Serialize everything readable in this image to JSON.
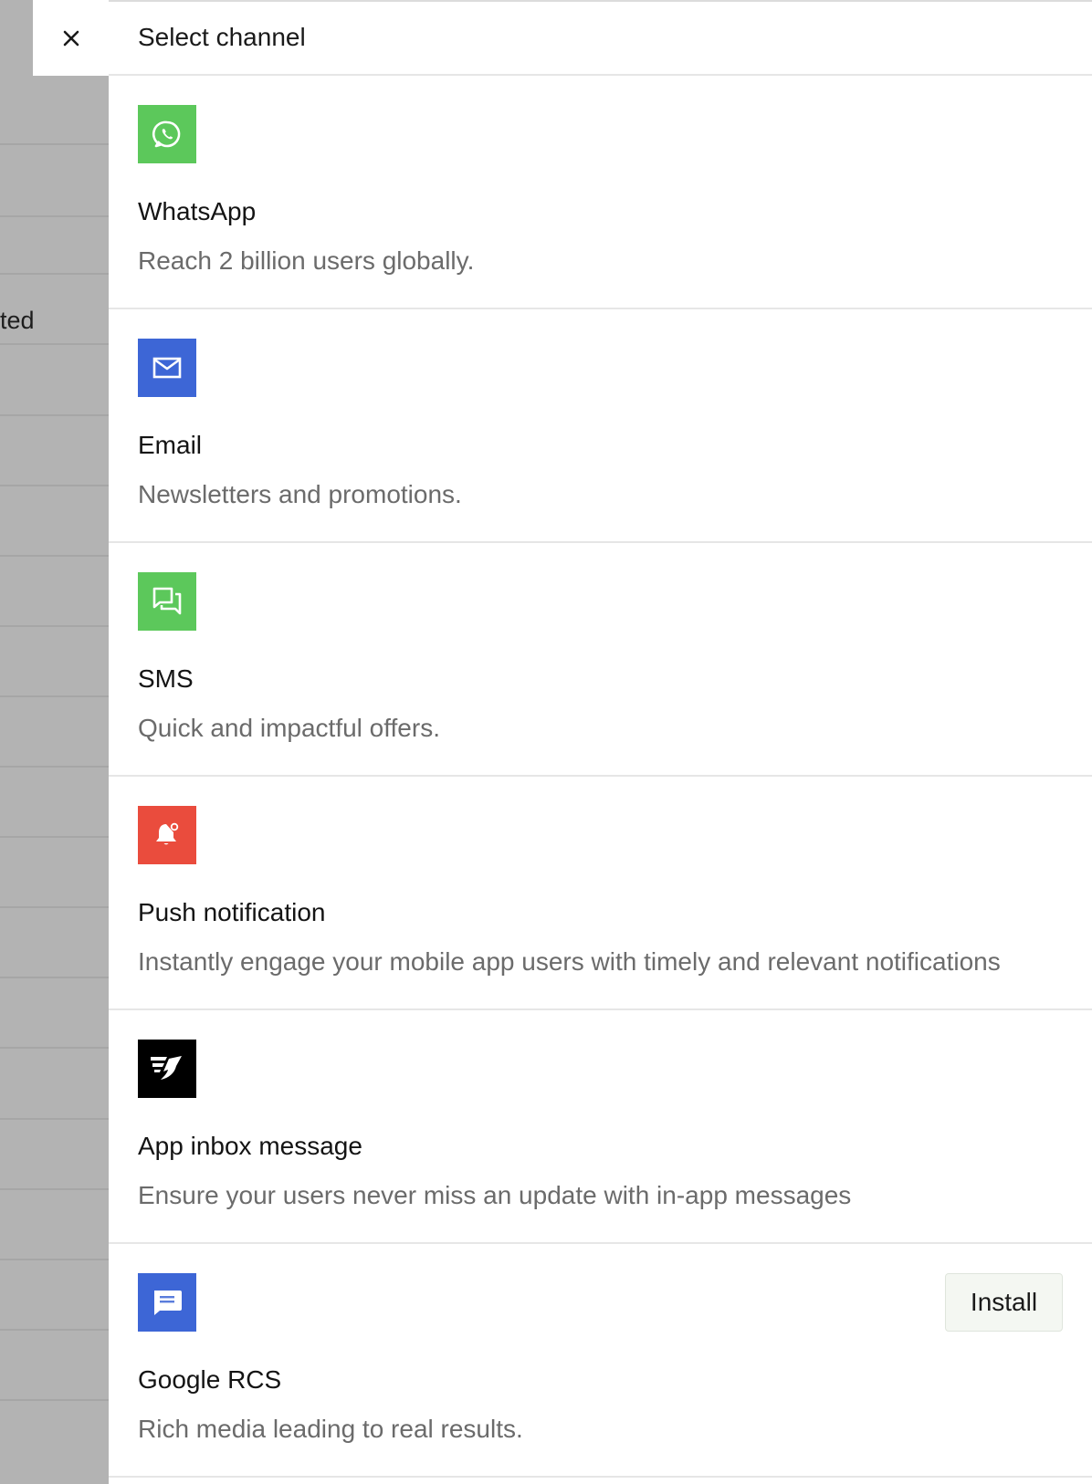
{
  "backdrop": {
    "partial_text": "ted"
  },
  "drawer": {
    "close_label": "×",
    "title": "Select channel"
  },
  "channels": [
    {
      "name": "WhatsApp",
      "description": "Reach 2 billion users globally.",
      "icon": "whatsapp-icon",
      "color": "#5cc85b"
    },
    {
      "name": "Email",
      "description": "Newsletters and promotions.",
      "icon": "mail-icon",
      "color": "#3d66d6"
    },
    {
      "name": "SMS",
      "description": "Quick and impactful offers.",
      "icon": "chat-icon",
      "color": "#5cc85b"
    },
    {
      "name": "Push notification",
      "description": "Instantly engage your mobile app users with timely and relevant notifications",
      "icon": "bell-icon",
      "color": "#ea4c3d"
    },
    {
      "name": "App inbox message",
      "description": "Ensure your users never miss an update with in-app messages",
      "icon": "app-inbox-icon",
      "color": "#000000"
    },
    {
      "name": "Google RCS",
      "description": "Rich media leading to real results.",
      "icon": "rcs-message-icon",
      "color": "#3d66d6",
      "action_label": "Install"
    }
  ]
}
